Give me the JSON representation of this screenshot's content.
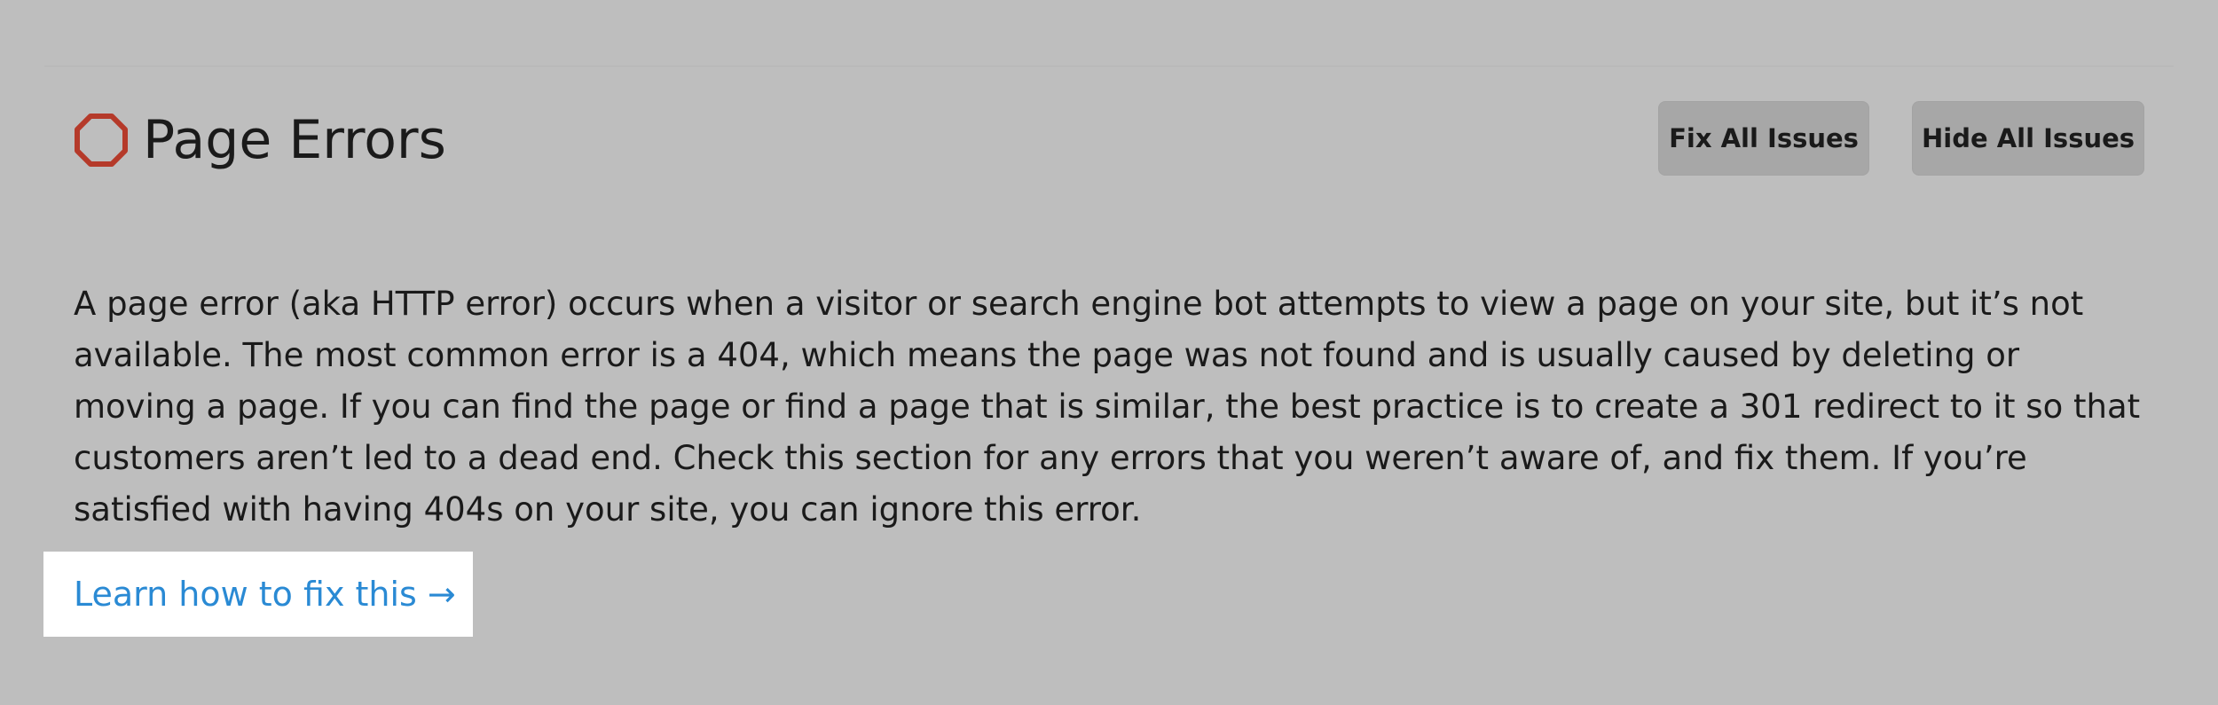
{
  "section": {
    "title": "Page Errors",
    "icon": "octagon-error-icon",
    "icon_color": "#b53a2a"
  },
  "actions": {
    "fix_all_label": "Fix All Issues",
    "hide_all_label": "Hide All Issues"
  },
  "description": "A page error (aka HTTP error) occurs when a visitor or search engine bot attempts to view a page on your site, but it’s not available. The most common error is a 404, which means the page was not found and is usually caused by deleting or moving a page. If you can find the page or find a page that is similar, the best practice is to create a 301 redirect to it so that customers aren’t led to a dead end. Check this section for any errors that you weren’t aware of, and fix them. If you’re satisfied with having 404s on your site, you can ignore this error.",
  "learn_link": {
    "label": "Learn how to fix this →",
    "color": "#2a8ad4"
  },
  "colors": {
    "background": "#bebebe",
    "button_bg": "#a7a7a7",
    "link_box_bg": "#ffffff"
  }
}
